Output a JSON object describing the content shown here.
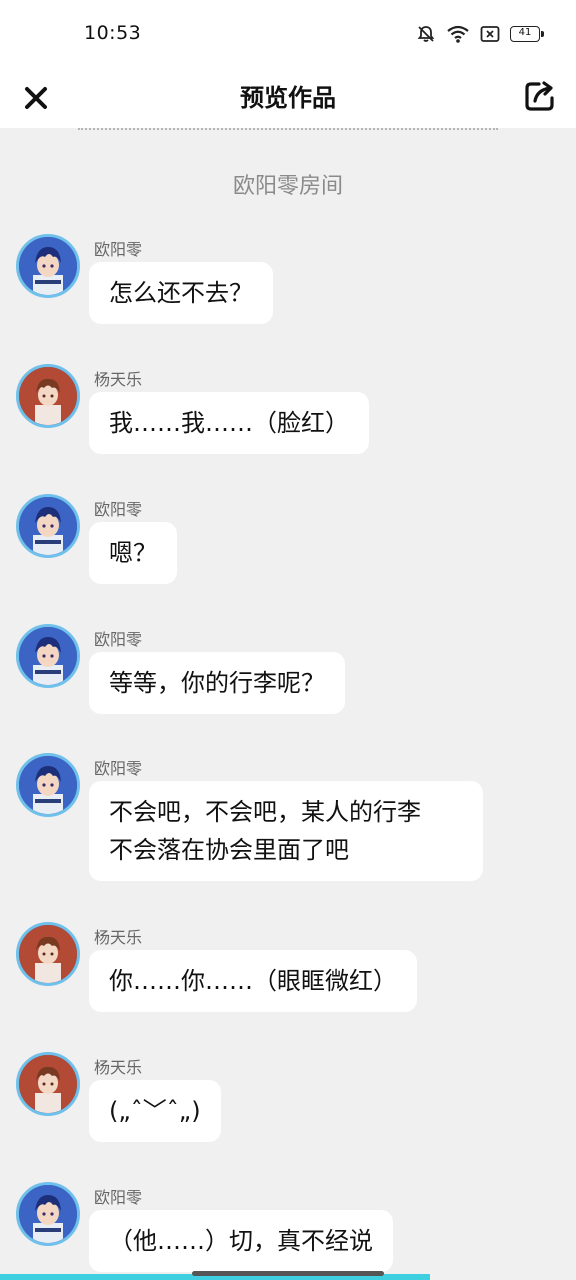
{
  "status_bar": {
    "time": "10:53",
    "battery": "41",
    "icons": [
      "bell-off-icon",
      "wifi-icon",
      "sim-off-icon",
      "battery-icon"
    ]
  },
  "header": {
    "title": "预览作品",
    "close_icon": "close-icon",
    "share_icon": "share-icon"
  },
  "room_title": "欧阳零房间",
  "messages": [
    {
      "sender": "欧阳零",
      "avatar": "blue-hair-boy",
      "text": "怎么还不去？"
    },
    {
      "sender": "杨天乐",
      "avatar": "brown-hair-boy",
      "text": "我……我……（脸红）"
    },
    {
      "sender": "欧阳零",
      "avatar": "blue-hair-boy",
      "text": "嗯？"
    },
    {
      "sender": "欧阳零",
      "avatar": "blue-hair-boy",
      "text": "等等，你的行李呢？"
    },
    {
      "sender": "欧阳零",
      "avatar": "blue-hair-boy",
      "text": "不会吧，不会吧，某人的行李\n不会落在协会里面了吧"
    },
    {
      "sender": "杨天乐",
      "avatar": "brown-hair-boy",
      "text": "你……你……（眼眶微红）"
    },
    {
      "sender": "杨天乐",
      "avatar": "brown-hair-boy",
      "text": "(„ˆ﹀ˆ„)"
    },
    {
      "sender": "欧阳零",
      "avatar": "blue-hair-boy",
      "text": "（他……）切，真不经说"
    }
  ],
  "colors": {
    "background": "#f0f0f0",
    "bubble": "#ffffff",
    "avatar_ring": "#6fc0ea",
    "accent": "#3ecfe0"
  }
}
